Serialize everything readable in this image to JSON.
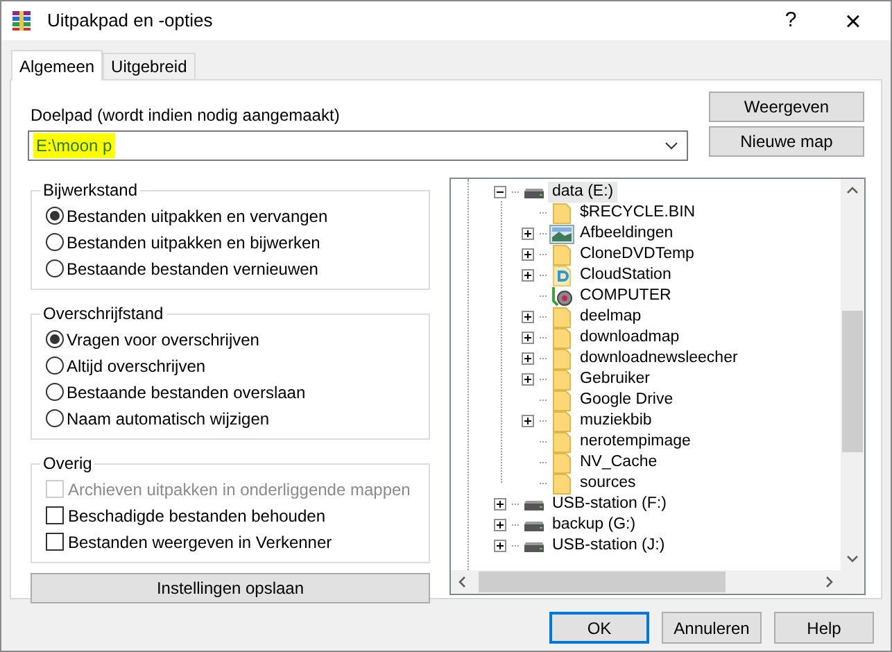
{
  "window": {
    "title": "Uitpakpad en -opties",
    "help": "?",
    "close": "×"
  },
  "tabs": [
    {
      "label": "Algemeen",
      "selected": true
    },
    {
      "label": "Uitgebreid",
      "selected": false
    }
  ],
  "destination": {
    "label": "Doelpad (wordt indien nodig aangemaakt)",
    "value": "E:\\moon p"
  },
  "side_buttons": [
    "Weergeven",
    "Nieuwe map"
  ],
  "groups": [
    {
      "title": "Bijwerkstand",
      "items": [
        {
          "kind": "radio",
          "label": "Bestanden uitpakken en vervangen",
          "selected": true,
          "disabled": false
        },
        {
          "kind": "radio",
          "label": "Bestanden uitpakken en bijwerken",
          "selected": false,
          "disabled": false
        },
        {
          "kind": "radio",
          "label": "Bestaande bestanden vernieuwen",
          "selected": false,
          "disabled": false
        }
      ]
    },
    {
      "title": "Overschrijfstand",
      "items": [
        {
          "kind": "radio",
          "label": "Vragen voor overschrijven",
          "selected": true,
          "disabled": false
        },
        {
          "kind": "radio",
          "label": "Altijd overschrijven",
          "selected": false,
          "disabled": false
        },
        {
          "kind": "radio",
          "label": "Bestaande bestanden overslaan",
          "selected": false,
          "disabled": false
        },
        {
          "kind": "radio",
          "label": "Naam automatisch wijzigen",
          "selected": false,
          "disabled": false
        }
      ]
    },
    {
      "title": "Overig",
      "items": [
        {
          "kind": "checkbox",
          "label": "Archieven uitpakken in onderliggende mappen",
          "checked": false,
          "disabled": true
        },
        {
          "kind": "checkbox",
          "label": "Beschadigde bestanden behouden",
          "checked": false,
          "disabled": false
        },
        {
          "kind": "checkbox",
          "label": "Bestanden weergeven in Verkenner",
          "checked": false,
          "disabled": false
        }
      ]
    }
  ],
  "save_button": "Instellingen opslaan",
  "tree": [
    {
      "kind": "drive",
      "label": "data (E:)",
      "expandable": true,
      "expanded": true,
      "selected": true,
      "children": [
        {
          "kind": "folder",
          "label": "$RECYCLE.BIN",
          "expandable": false,
          "selected": false
        },
        {
          "kind": "pictures",
          "label": "Afbeeldingen",
          "expandable": true,
          "expanded": false,
          "selected": false
        },
        {
          "kind": "folder",
          "label": "CloneDVDTemp",
          "expandable": true,
          "expanded": false,
          "selected": false
        },
        {
          "kind": "cloud",
          "label": "CloudStation",
          "expandable": true,
          "expanded": false,
          "selected": false
        },
        {
          "kind": "computer",
          "label": "COMPUTER",
          "expandable": false,
          "selected": false
        },
        {
          "kind": "folder",
          "label": "deelmap",
          "expandable": true,
          "expanded": false,
          "selected": false
        },
        {
          "kind": "folder",
          "label": "downloadmap",
          "expandable": true,
          "expanded": false,
          "selected": false
        },
        {
          "kind": "folder",
          "label": "downloadnewsleecher",
          "expandable": true,
          "expanded": false,
          "selected": false
        },
        {
          "kind": "folder",
          "label": "Gebruiker",
          "expandable": true,
          "expanded": false,
          "selected": false
        },
        {
          "kind": "folder",
          "label": "Google Drive",
          "expandable": false,
          "selected": false
        },
        {
          "kind": "folder",
          "label": "muziekbib",
          "expandable": true,
          "expanded": false,
          "selected": false
        },
        {
          "kind": "folder",
          "label": "nerotempimage",
          "expandable": false,
          "selected": false
        },
        {
          "kind": "folder",
          "label": "NV_Cache",
          "expandable": false,
          "selected": false
        },
        {
          "kind": "folder",
          "label": "sources",
          "expandable": false,
          "selected": false
        }
      ]
    },
    {
      "kind": "drive",
      "label": "USB-station (F:)",
      "expandable": true,
      "expanded": false,
      "selected": false
    },
    {
      "kind": "drive",
      "label": "backup (G:)",
      "expandable": true,
      "expanded": false,
      "selected": false
    },
    {
      "kind": "drive",
      "label": "USB-station (J:)",
      "expandable": true,
      "expanded": false,
      "selected": false
    }
  ],
  "buttons": [
    {
      "label": "OK",
      "default": true
    },
    {
      "label": "Annuleren",
      "default": false
    },
    {
      "label": "Help",
      "default": false
    }
  ]
}
